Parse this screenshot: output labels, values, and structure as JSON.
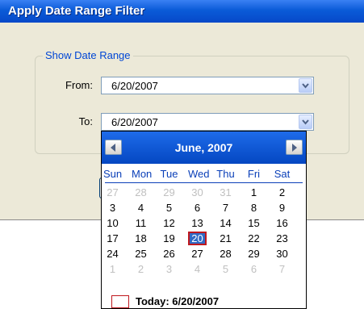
{
  "window": {
    "title": "Apply Date Range Filter"
  },
  "group": {
    "label": "Show Date Range"
  },
  "from": {
    "label": "From:",
    "value": "6/20/2007"
  },
  "to": {
    "label": "To:",
    "value": "6/20/2007"
  },
  "calendar": {
    "month_title": "June, 2007",
    "prev_icon": "triangle-left-icon",
    "next_icon": "triangle-right-icon",
    "days_of_week": [
      "Sun",
      "Mon",
      "Tue",
      "Wed",
      "Thu",
      "Fri",
      "Sat"
    ],
    "weeks": [
      [
        "27",
        "28",
        "29",
        "30",
        "31",
        "1",
        "2"
      ],
      [
        "3",
        "4",
        "5",
        "6",
        "7",
        "8",
        "9"
      ],
      [
        "10",
        "11",
        "12",
        "13",
        "14",
        "15",
        "16"
      ],
      [
        "17",
        "18",
        "19",
        "20",
        "21",
        "22",
        "23"
      ],
      [
        "24",
        "25",
        "26",
        "27",
        "28",
        "29",
        "30"
      ],
      [
        "1",
        "2",
        "3",
        "4",
        "5",
        "6",
        "7"
      ]
    ],
    "selected_day": "20",
    "today_label": "Today: 6/20/2007"
  },
  "colors": {
    "titlebar": "#0a5bd8",
    "calendar_header": "#0a5bd8",
    "selection": "#316ac5",
    "today_outline": "#c0181e"
  }
}
